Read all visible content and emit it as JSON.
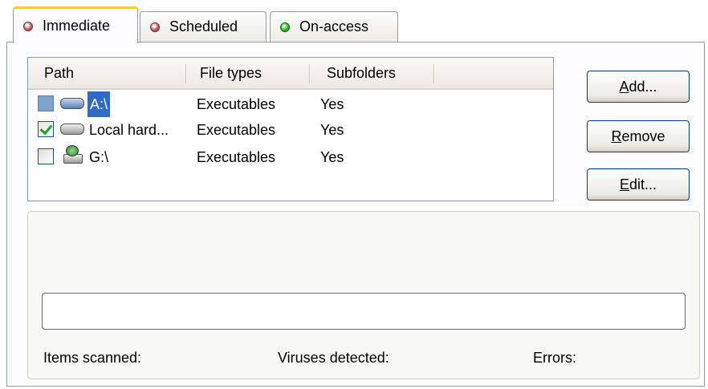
{
  "tabs": [
    {
      "label": "Immediate",
      "icon": "red-status-icon",
      "active": true
    },
    {
      "label": "Scheduled",
      "icon": "red-status-icon",
      "active": false
    },
    {
      "label": "On-access",
      "icon": "green-status-icon",
      "active": false
    }
  ],
  "list": {
    "columns": [
      "Path",
      "File types",
      "Subfolders"
    ],
    "rows": [
      {
        "path": "A:\\",
        "file_types": "Executables",
        "subfolders": "Yes",
        "checked": false,
        "selected": true,
        "icon": "floppy-drive-icon"
      },
      {
        "path": "Local hard...",
        "file_types": "Executables",
        "subfolders": "Yes",
        "checked": true,
        "selected": false,
        "icon": "hard-drive-icon"
      },
      {
        "path": "G:\\",
        "file_types": "Executables",
        "subfolders": "Yes",
        "checked": false,
        "selected": false,
        "icon": "network-drive-icon"
      }
    ]
  },
  "buttons": {
    "add": {
      "mnemonic": "A",
      "rest": "dd..."
    },
    "remove": {
      "mnemonic": "R",
      "rest": "emove"
    },
    "edit": {
      "mnemonic": "E",
      "rest": "dit..."
    }
  },
  "progress": {
    "value": 0
  },
  "status": {
    "items_scanned": "Items scanned:",
    "viruses_detected": "Viruses detected:",
    "errors": "Errors:"
  },
  "colors": {
    "active_tab_accent": "#ffc83c",
    "selection": "#316ac5",
    "check": "#21a121"
  }
}
